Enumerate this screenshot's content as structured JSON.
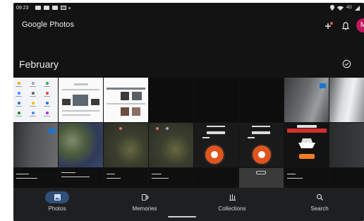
{
  "status_bar": {
    "time": "09:23",
    "network": "4G",
    "icons": [
      "notification-icon",
      "notification-icon",
      "notification-icon",
      "image-icon",
      "dot-icon",
      "location-icon",
      "wifi-icon",
      "signal-icon"
    ]
  },
  "app_bar": {
    "title": "Google Photos",
    "add_icon": "add-icon",
    "notifications_icon": "bell-icon",
    "avatar_initial": "M",
    "avatar_color": "#c2185b"
  },
  "section": {
    "month": "February",
    "select_icon": "check-circle-icon"
  },
  "grid": {
    "rows": 3,
    "columns": 8,
    "tile_count": 24
  },
  "bottom_nav": {
    "items": [
      {
        "label": "Photos",
        "icon": "photos-icon",
        "active": true
      },
      {
        "label": "Memories",
        "icon": "memories-icon",
        "active": false
      },
      {
        "label": "Collections",
        "icon": "collections-icon",
        "active": false
      },
      {
        "label": "Search",
        "icon": "search-icon",
        "active": false
      }
    ],
    "active_color": "#2f4f77"
  },
  "colors": {
    "background": "#131313",
    "nav_background": "#1e1f20",
    "text": "#f1f1f1"
  }
}
